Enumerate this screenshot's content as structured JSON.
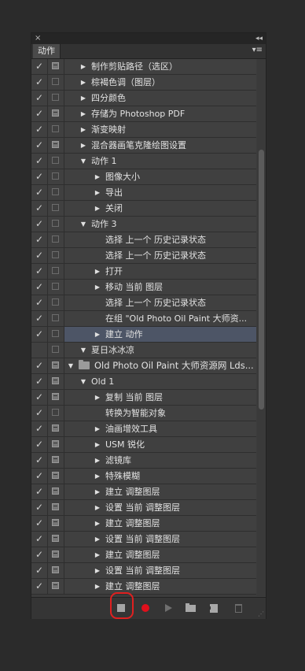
{
  "panel": {
    "close_glyph": "×",
    "collapse_glyph": "◂◂",
    "tab_label": "动作",
    "menu_glyph": "▾≡"
  },
  "rows": [
    {
      "check": true,
      "dialog": "filled",
      "indent": 0,
      "toggle": "collapsed",
      "label": "制作剪贴路径（选区）"
    },
    {
      "check": true,
      "dialog": "empty",
      "indent": 0,
      "toggle": "collapsed",
      "label": "棕褐色调（图层）"
    },
    {
      "check": true,
      "dialog": "empty",
      "indent": 0,
      "toggle": "collapsed",
      "label": "四分颜色"
    },
    {
      "check": true,
      "dialog": "filled",
      "indent": 0,
      "toggle": "collapsed",
      "label": "存储为 Photoshop PDF"
    },
    {
      "check": true,
      "dialog": "empty",
      "indent": 0,
      "toggle": "collapsed",
      "label": "渐变映射"
    },
    {
      "check": true,
      "dialog": "filled",
      "indent": 0,
      "toggle": "collapsed",
      "label": "混合器画笔克隆绘图设置"
    },
    {
      "check": true,
      "dialog": "empty",
      "indent": 0,
      "toggle": "expanded",
      "label": "动作 1"
    },
    {
      "check": true,
      "dialog": "empty",
      "indent": 1,
      "toggle": "collapsed",
      "label": "图像大小"
    },
    {
      "check": true,
      "dialog": "empty",
      "indent": 1,
      "toggle": "collapsed",
      "label": "导出"
    },
    {
      "check": true,
      "dialog": "empty",
      "indent": 1,
      "toggle": "collapsed",
      "label": "关闭"
    },
    {
      "check": true,
      "dialog": "empty",
      "indent": 0,
      "toggle": "expanded",
      "label": "动作 3"
    },
    {
      "check": true,
      "dialog": "empty",
      "indent": 1,
      "toggle": "none",
      "label": "选择 上一个 历史记录状态"
    },
    {
      "check": true,
      "dialog": "empty",
      "indent": 1,
      "toggle": "none",
      "label": "选择 上一个 历史记录状态"
    },
    {
      "check": true,
      "dialog": "empty",
      "indent": 1,
      "toggle": "collapsed",
      "label": "打开"
    },
    {
      "check": true,
      "dialog": "empty",
      "indent": 1,
      "toggle": "collapsed",
      "label": "移动 当前 图层"
    },
    {
      "check": true,
      "dialog": "empty",
      "indent": 1,
      "toggle": "none",
      "label": "选择 上一个 历史记录状态"
    },
    {
      "check": true,
      "dialog": "empty",
      "indent": 1,
      "toggle": "none",
      "label": "在组 \"Old Photo Oil Paint 大师资..."
    },
    {
      "check": true,
      "dialog": "empty",
      "indent": 1,
      "toggle": "collapsed",
      "label": "建立 动作",
      "selected": true
    },
    {
      "check": false,
      "dialog": "empty",
      "indent": 0,
      "toggle": "expanded",
      "label": "夏日冰冰凉"
    },
    {
      "check": true,
      "dialog": "filled",
      "indent": -1,
      "toggle": "expanded",
      "folder": true,
      "label": "Old Photo Oil Paint 大师资源网 Lds..."
    },
    {
      "check": true,
      "dialog": "filled",
      "indent": 0,
      "toggle": "expanded",
      "label": "Old 1"
    },
    {
      "check": true,
      "dialog": "filled",
      "indent": 1,
      "toggle": "collapsed",
      "label": "复制 当前 图层"
    },
    {
      "check": true,
      "dialog": "empty",
      "indent": 1,
      "toggle": "none",
      "label": "转换为智能对象"
    },
    {
      "check": true,
      "dialog": "filled",
      "indent": 1,
      "toggle": "collapsed",
      "label": "油画增效工具"
    },
    {
      "check": true,
      "dialog": "filled",
      "indent": 1,
      "toggle": "collapsed",
      "label": "USM 锐化"
    },
    {
      "check": true,
      "dialog": "filled",
      "indent": 1,
      "toggle": "collapsed",
      "label": "滤镜库"
    },
    {
      "check": true,
      "dialog": "filled",
      "indent": 1,
      "toggle": "collapsed",
      "label": "特殊模糊"
    },
    {
      "check": true,
      "dialog": "filled",
      "indent": 1,
      "toggle": "collapsed",
      "label": "建立 调整图层"
    },
    {
      "check": true,
      "dialog": "filled",
      "indent": 1,
      "toggle": "collapsed",
      "label": "设置 当前 调整图层"
    },
    {
      "check": true,
      "dialog": "filled",
      "indent": 1,
      "toggle": "collapsed",
      "label": "建立 调整图层"
    },
    {
      "check": true,
      "dialog": "filled",
      "indent": 1,
      "toggle": "collapsed",
      "label": "设置 当前 调整图层"
    },
    {
      "check": true,
      "dialog": "filled",
      "indent": 1,
      "toggle": "collapsed",
      "label": "建立 调整图层"
    },
    {
      "check": true,
      "dialog": "filled",
      "indent": 1,
      "toggle": "collapsed",
      "label": "设置 当前 调整图层"
    },
    {
      "check": true,
      "dialog": "filled",
      "indent": 1,
      "toggle": "collapsed",
      "label": "建立 调整图层"
    }
  ],
  "toolbar": {
    "stop": "stop-icon",
    "record": "record-icon",
    "play": "play-icon",
    "new_set": "folder-icon",
    "new_action": "new-action-icon",
    "delete": "trash-icon"
  },
  "colors": {
    "record": "#e0101c",
    "highlight": "#e02020",
    "selected_row": "#4d5566"
  }
}
